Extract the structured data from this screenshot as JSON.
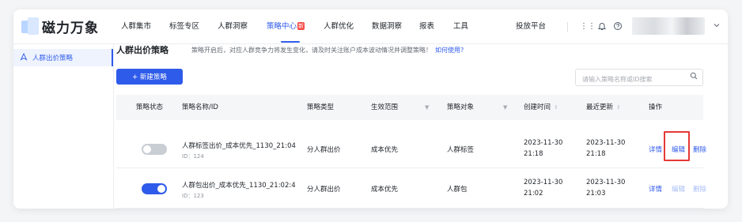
{
  "brand": {
    "name": "磁力万象"
  },
  "nav": {
    "items": [
      "人群集市",
      "标签专区",
      "人群洞察",
      "策略中心",
      "人群优化",
      "数据洞察",
      "报表",
      "工具"
    ],
    "new_badge": "新",
    "delivery_platform": "投放平台",
    "icons": [
      "grid-icon",
      "bell-icon",
      "help-icon"
    ]
  },
  "sidebar": {
    "items": [
      {
        "label": "人群出价策略",
        "icon": "strategy-icon"
      }
    ]
  },
  "header": {
    "title": "人群出价策略",
    "description": "策略开启后，对应人群竞争力将发生变化，请及时关注账户成本波动情况并调整策略！",
    "help_link": "如何使用?"
  },
  "toolbar": {
    "new_button": "+ 新建策略"
  },
  "search": {
    "placeholder": "请输入策略名称或ID搜索",
    "value": ""
  },
  "table": {
    "columns": [
      "策略状态",
      "策略名称/ID",
      "策略类型",
      "生效范围",
      "策略对象",
      "创建时间",
      "最近更新",
      "操作"
    ],
    "rows": [
      {
        "status": "off",
        "name": "人群标签出价_成本优先_1130_21:04",
        "id": "ID：124",
        "type": "分人群出价",
        "scope": "成本优先",
        "target": "人群标签",
        "created_date": "2023-11-30",
        "created_time": "21:18",
        "updated_date": "2023-11-30",
        "updated_time": "21:18",
        "actions": {
          "detail": "详情",
          "edit": "编辑",
          "delete": "删除"
        }
      },
      {
        "status": "on",
        "name": "人群包出价_成本优先_1130_21:02:4",
        "id": "ID：123",
        "type": "分人群出价",
        "scope": "成本优先",
        "target": "人群包",
        "created_date": "2023-11-30",
        "created_time": "21:02",
        "updated_date": "2023-11-30",
        "updated_time": "21:03",
        "actions": {
          "detail": "详情",
          "edit": "编辑",
          "delete": "删除"
        }
      }
    ]
  },
  "colors": {
    "accent": "#2f5bea",
    "highlight": "#e53935",
    "new_badge": "#f54a45"
  }
}
